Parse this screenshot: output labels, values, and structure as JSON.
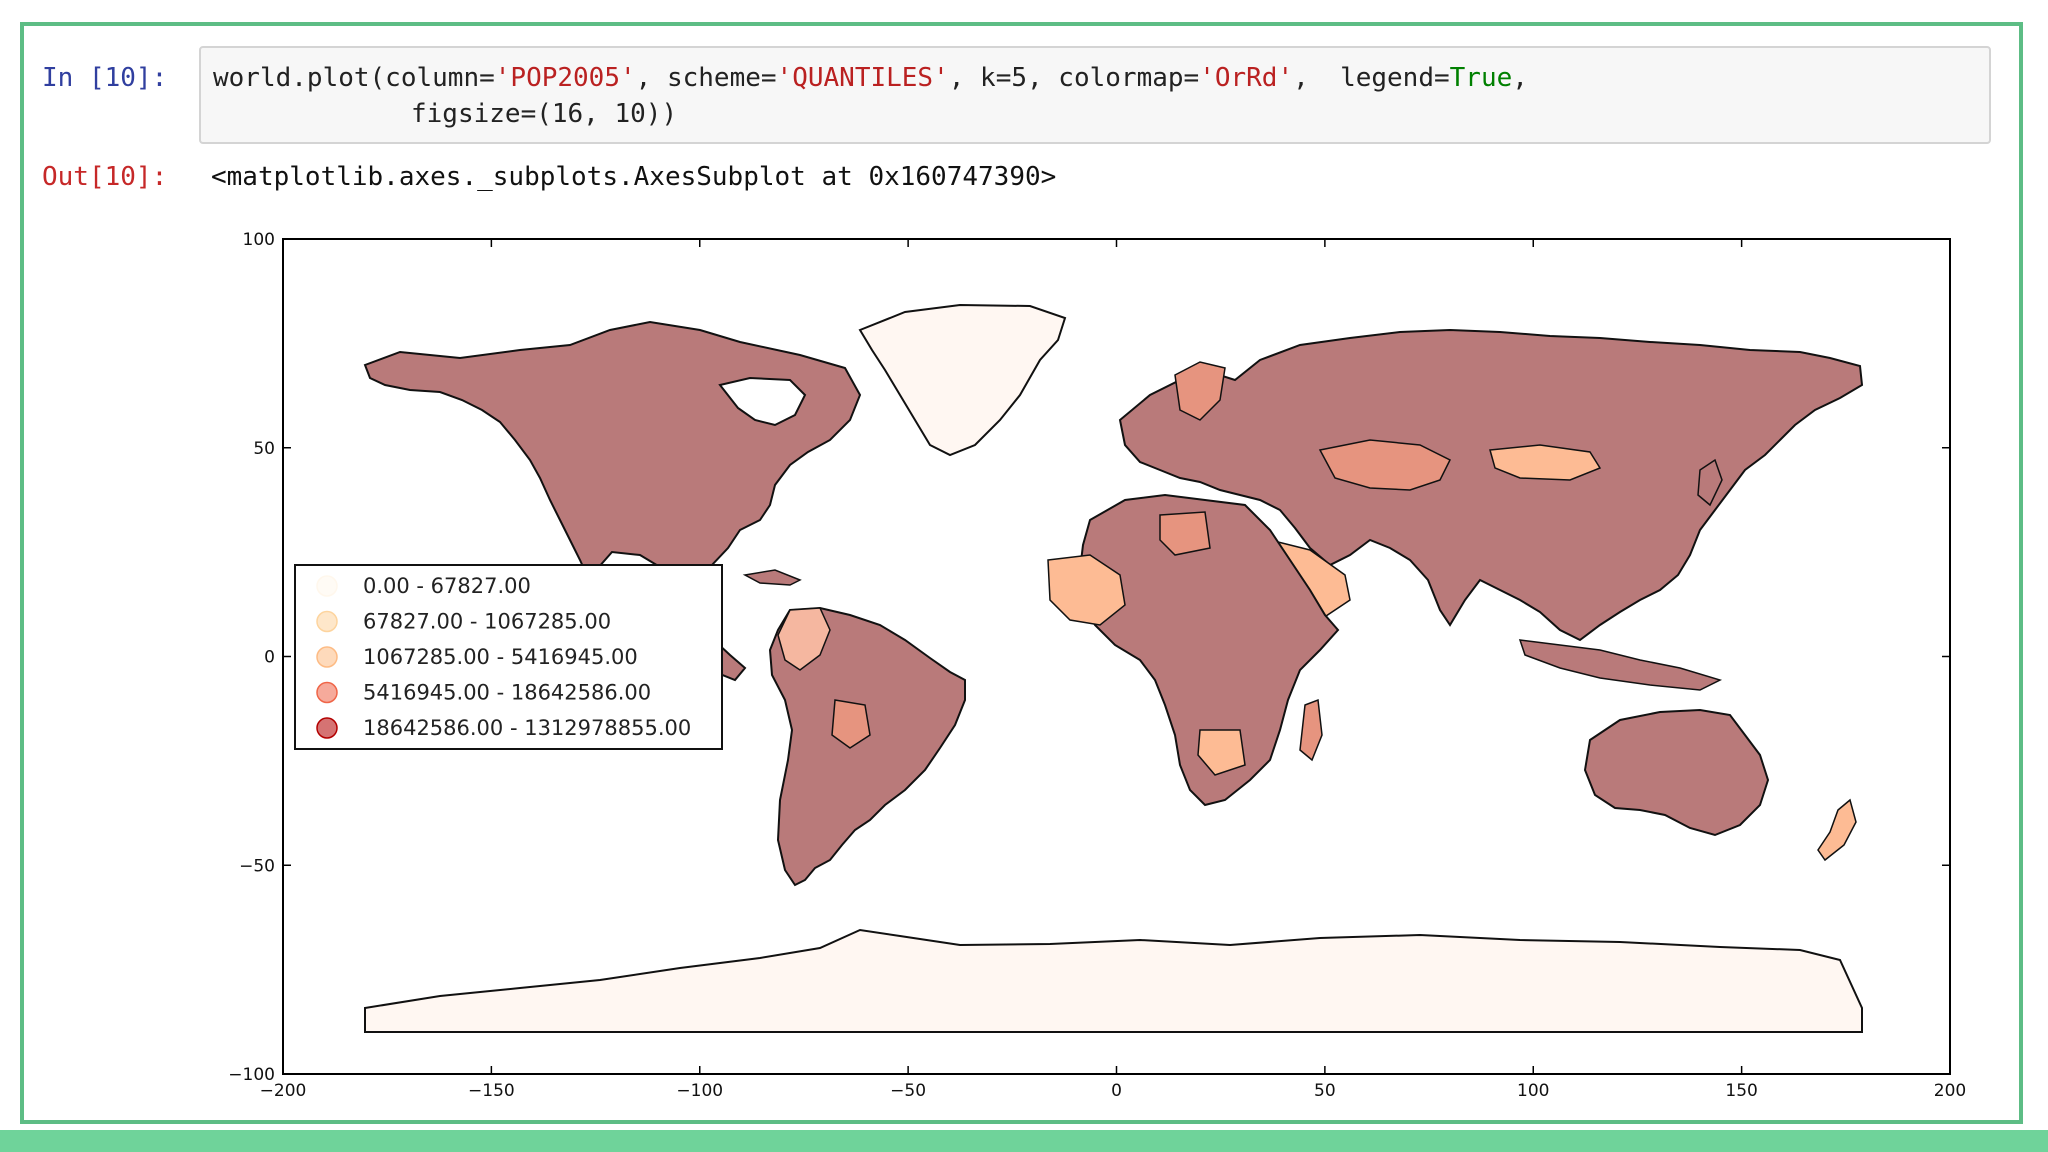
{
  "notebook": {
    "in_prompt": "In [10]:",
    "out_prompt": "Out[10]:",
    "code": {
      "l1_a": "world.plot(column=",
      "l1_col": "'POP2005'",
      "l1_b": ", scheme=",
      "l1_scheme": "'QUANTILES'",
      "l1_c": ", k=5, colormap=",
      "l1_cmap": "'OrRd'",
      "l1_d": ",  legend=",
      "l1_true": "True",
      "l1_e": ",",
      "l2": "figsize=(16, 10))"
    },
    "output_text": "<matplotlib.axes._subplots.AxesSubplot at 0x160747390>"
  },
  "chart_data": {
    "type": "choropleth",
    "title": "",
    "xlabel": "",
    "ylabel": "",
    "xlim": [
      -200,
      200
    ],
    "ylim": [
      -100,
      100
    ],
    "x_ticks": [
      -200,
      -150,
      -100,
      -50,
      0,
      50,
      100,
      150,
      200
    ],
    "y_ticks": [
      100,
      50,
      0,
      -50,
      -100
    ],
    "x_tick_labels": [
      "−200",
      "−150",
      "−100",
      "−50",
      "0",
      "50",
      "100",
      "150",
      "200"
    ],
    "y_tick_labels": [
      "100",
      "50",
      "0",
      "−50",
      "−100"
    ],
    "grid": false,
    "legend_position": "center-left",
    "legend": [
      {
        "label": "0.00 - 67827.00",
        "color": "#fff7ec"
      },
      {
        "label": "67827.00 - 1067285.00",
        "color": "#fdd49e"
      },
      {
        "label": "1067285.00 - 5416945.00",
        "color": "#fdbb84"
      },
      {
        "label": "5416945.00 - 18642586.00",
        "color": "#ef6548"
      },
      {
        "label": "18642586.00 - 1312978855.00",
        "color": "#b30000"
      }
    ]
  }
}
